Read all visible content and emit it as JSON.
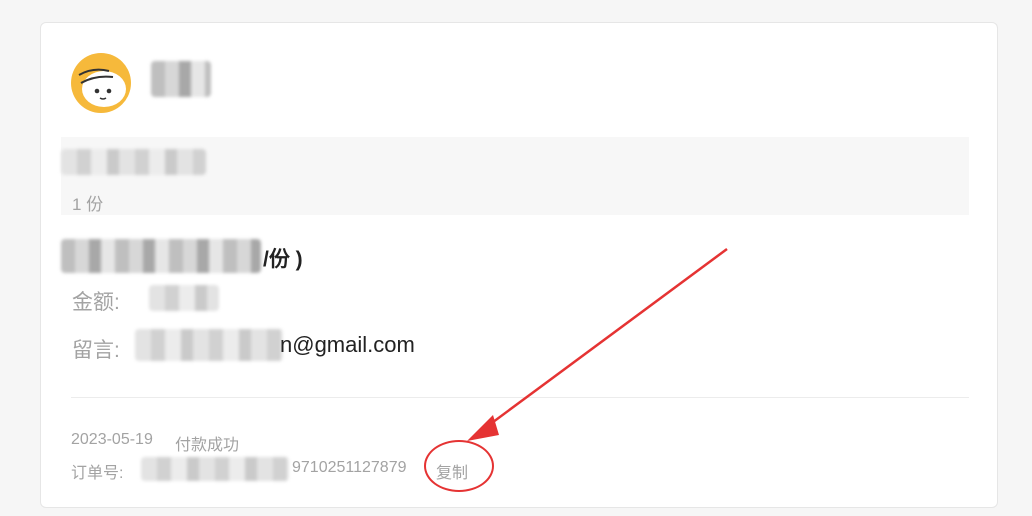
{
  "order": {
    "quantity_text": "1 份",
    "price_suffix": "/份 )",
    "amount_label": "金额:",
    "message_label": "留言:",
    "message_suffix": "n@gmail.com",
    "date": "2023-05-19",
    "status": "付款成功",
    "order_no_label": "订单号:",
    "order_no_suffix": "9710251127879",
    "copy_label": "复制"
  },
  "colors": {
    "avatar": "#f6b93b",
    "annotation": "#e53333",
    "muted_text": "#a3a3a3",
    "dark_text": "#222222"
  },
  "icons": {
    "avatar": "cartoon-face-avatar"
  }
}
